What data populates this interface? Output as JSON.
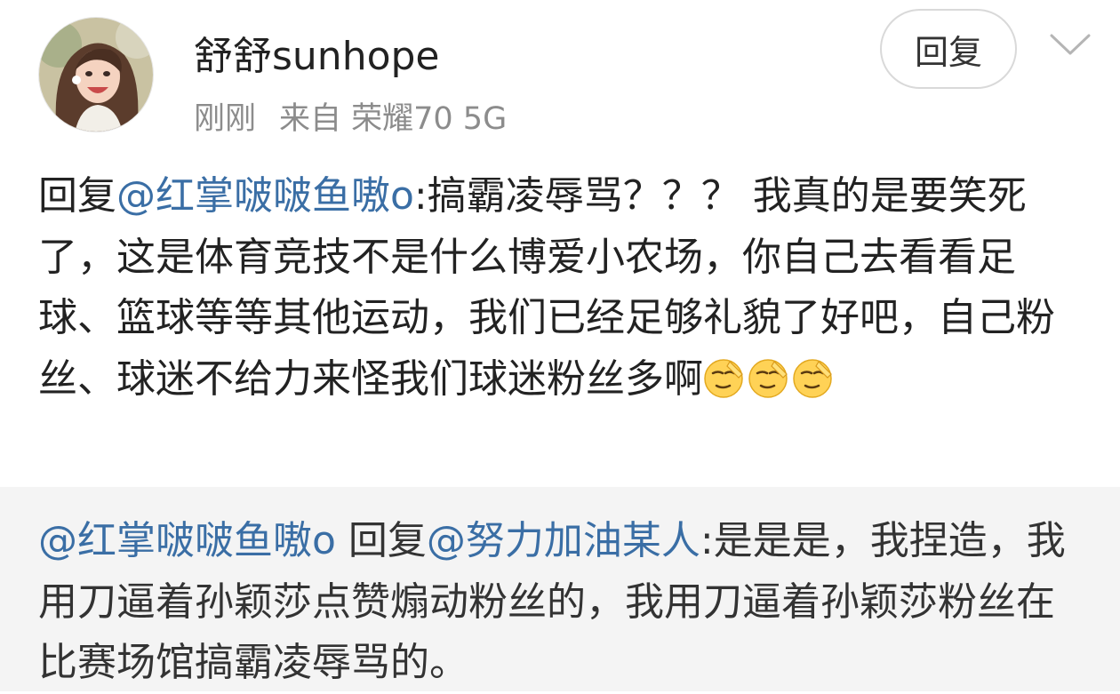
{
  "post": {
    "user_name": "舒舒sunhope",
    "time": "刚刚",
    "source": "来自 荣耀70 5G",
    "reply_button_label": "回复",
    "avatar_icon": "user-avatar-photo",
    "menu_icon": "chevron-down-icon",
    "text": {
      "prefix": "回复",
      "mention": "@红掌啵啵鱼嗷o",
      "content": ":搞霸凌辱骂？？？ 我真的是要笑死了，这是体育竞技不是什么博爱小农场，你自己去看看足球、篮球等等其他运动，我们已经足够礼貌了好吧，自己粉丝、球迷不给力来怪我们球迷粉丝多啊",
      "emojis": [
        "salute-face-emoji",
        "salute-face-emoji",
        "salute-face-emoji"
      ]
    }
  },
  "quoted": {
    "author_mention": "@红掌啵啵鱼嗷o",
    "reply_word": " 回复",
    "target_mention": "@努力加油某人",
    "content": ":是是是，我捏造，我用刀逼着孙颖莎点赞煽动粉丝的，我用刀逼着孙颖莎粉丝在比赛场馆搞霸凌辱骂的。"
  },
  "colors": {
    "mention": "#3a6ea5",
    "text": "#222222",
    "meta": "#8c8c8c",
    "quote_background": "#f4f4f4"
  }
}
